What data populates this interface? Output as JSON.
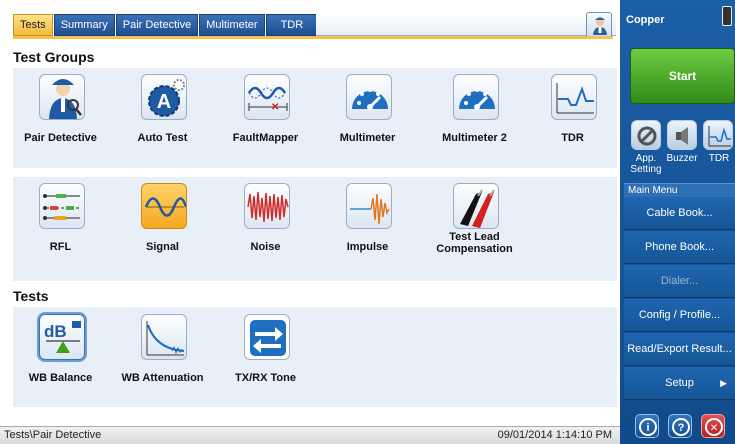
{
  "tabs": [
    {
      "label": "Tests",
      "active": true
    },
    {
      "label": "Summary",
      "active": false
    },
    {
      "label": "Pair Detective",
      "active": false
    },
    {
      "label": "Multimeter",
      "active": false
    },
    {
      "label": "TDR",
      "active": false
    }
  ],
  "sections": {
    "test_groups_title": "Test Groups",
    "tests_title": "Tests"
  },
  "test_groups": [
    {
      "label": "Pair Detective",
      "icon": "detective-icon"
    },
    {
      "label": "Auto Test",
      "icon": "auto-test-gear-icon"
    },
    {
      "label": "FaultMapper",
      "icon": "fault-mapper-icon"
    },
    {
      "label": "Multimeter",
      "icon": "gauge-icon"
    },
    {
      "label": "Multimeter 2",
      "icon": "gauge-icon"
    },
    {
      "label": "TDR",
      "icon": "tdr-trace-icon"
    },
    {
      "label": "RFL",
      "icon": "rfl-icon"
    },
    {
      "label": "Signal",
      "icon": "sine-wave-icon"
    },
    {
      "label": "Noise",
      "icon": "noise-icon"
    },
    {
      "label": "Impulse",
      "icon": "impulse-icon"
    },
    {
      "label": "Test Lead Compensation",
      "icon": "test-leads-icon"
    }
  ],
  "tests": [
    {
      "label": "WB Balance",
      "icon": "db-balance-icon"
    },
    {
      "label": "WB Attenuation",
      "icon": "attenuation-curve-icon"
    },
    {
      "label": "TX/RX Tone",
      "icon": "tx-rx-arrows-icon"
    }
  ],
  "status": {
    "path": "Tests\\Pair Detective",
    "datetime": "09/01/2014 1:14:10 PM"
  },
  "sidebar": {
    "title": "Copper",
    "start_label": "Start",
    "quick": [
      {
        "label": "App. Setting",
        "icon": "wrench-icon"
      },
      {
        "label": "Buzzer",
        "icon": "speaker-icon"
      },
      {
        "label": "TDR",
        "icon": "tdr-trace-icon"
      }
    ],
    "menu_header": "Main Menu",
    "menu_items": [
      {
        "label": "Cable Book...",
        "enabled": true
      },
      {
        "label": "Phone Book...",
        "enabled": true
      },
      {
        "label": "Dialer...",
        "enabled": false
      },
      {
        "label": "Config / Profile...",
        "enabled": true
      },
      {
        "label": "Read/Export Result...",
        "enabled": true
      },
      {
        "label": "Setup",
        "enabled": true
      }
    ],
    "setup_arrow": "▶",
    "bottom_buttons": [
      {
        "icon": "info-icon",
        "glyph": "i"
      },
      {
        "icon": "help-icon",
        "glyph": "?"
      },
      {
        "icon": "close-icon",
        "glyph": "✕"
      }
    ]
  },
  "colors": {
    "accent_blue": "#1b5fa8",
    "active_tab": "#f2b93b",
    "start_green": "#3fa01e",
    "close_red": "#d03030"
  }
}
